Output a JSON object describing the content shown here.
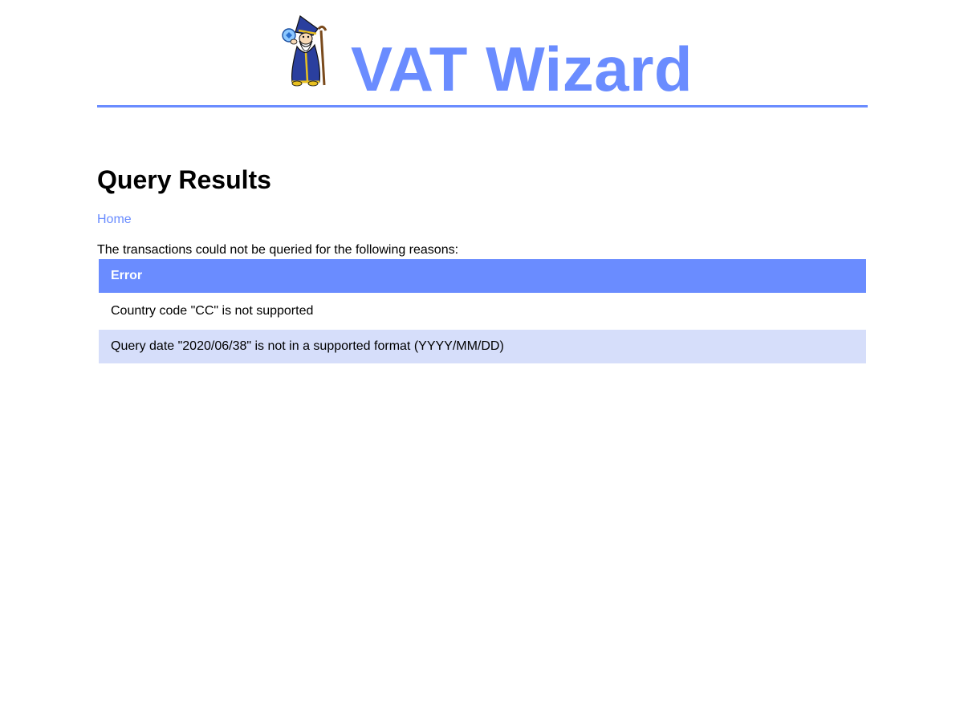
{
  "header": {
    "title": "VAT Wizard",
    "logo": "wizard-logo",
    "accent_color": "#6a8cff"
  },
  "page": {
    "title": "Query Results",
    "home_link": "Home",
    "intro": "The transactions could not be queried for the following reasons:"
  },
  "errors_table": {
    "header": "Error",
    "rows": [
      "Country code \"CC\" is not supported",
      "Query date \"2020/06/38\" is not in a supported format (YYYY/MM/DD)"
    ]
  }
}
